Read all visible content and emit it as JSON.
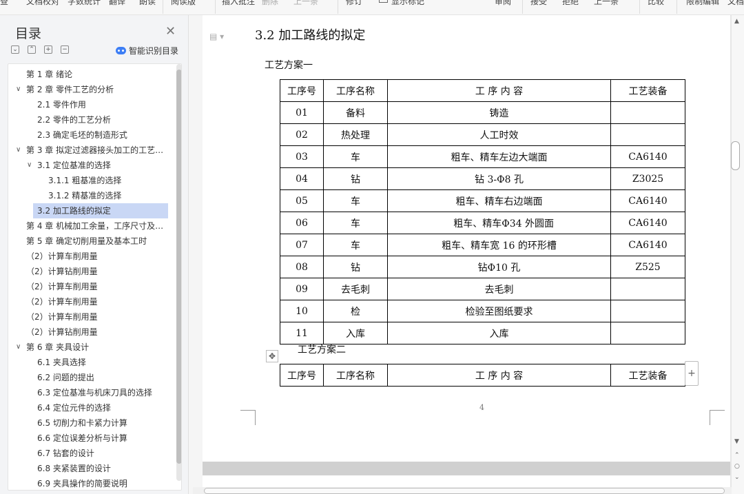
{
  "toolbar": {
    "items": [
      "查",
      "文档校对",
      "字数统计",
      "翻译",
      "朗读",
      "阅读版",
      "插入批注",
      "删除",
      "上一条",
      "下一条",
      "修订",
      "显示标记",
      "审阅",
      "接受",
      "拒绝",
      "上一条",
      "下一条",
      "比较",
      "限制编辑",
      "文档"
    ]
  },
  "nav": {
    "title": "目录",
    "smart_toc": "智能识别目录",
    "toc": [
      {
        "label": "第 1 章 绪论",
        "level": 0,
        "caret": ""
      },
      {
        "label": "第 2 章 零件工艺的分析",
        "level": 0,
        "caret": "∨"
      },
      {
        "label": "2.1 零件作用",
        "level": 1,
        "caret": ""
      },
      {
        "label": "2.2 零件的工艺分析",
        "level": 1,
        "caret": ""
      },
      {
        "label": "2.3 确定毛坯的制造形式",
        "level": 1,
        "caret": ""
      },
      {
        "label": "第 3 章 拟定过滤器接头加工的工艺…",
        "level": 0,
        "caret": "∨"
      },
      {
        "label": "3.1 定位基准的选择",
        "level": 1,
        "caret": "∨"
      },
      {
        "label": "3.1.1 粗基准的选择",
        "level": 2,
        "caret": ""
      },
      {
        "label": "3.1.2 精基准的选择",
        "level": 2,
        "caret": ""
      },
      {
        "label": "3.2 加工路线的拟定",
        "level": 1,
        "caret": "",
        "selected": true
      },
      {
        "label": "第 4 章 机械加工余量，工序尺寸及…",
        "level": 0,
        "caret": ""
      },
      {
        "label": "第 5 章 确定切削用量及基本工时",
        "level": 0,
        "caret": ""
      },
      {
        "label": "（2）计算车削用量",
        "level": 0,
        "caret": ""
      },
      {
        "label": "（2）计算钻削用量",
        "level": 0,
        "caret": ""
      },
      {
        "label": "（2）计算车削用量",
        "level": 0,
        "caret": ""
      },
      {
        "label": "（2）计算车削用量",
        "level": 0,
        "caret": ""
      },
      {
        "label": "（2）计算车削用量",
        "level": 0,
        "caret": ""
      },
      {
        "label": "（2）计算钻削用量",
        "level": 0,
        "caret": ""
      },
      {
        "label": "第 6 章 夹具设计",
        "level": 0,
        "caret": "∨"
      },
      {
        "label": "6.1 夹具选择",
        "level": 1,
        "caret": ""
      },
      {
        "label": "6.2 问题的提出",
        "level": 1,
        "caret": ""
      },
      {
        "label": "6.3 定位基准与机床刀具的选择",
        "level": 1,
        "caret": ""
      },
      {
        "label": "6.4 定位元件的选择",
        "level": 1,
        "caret": ""
      },
      {
        "label": "6.5 切削力和卡紧力计算",
        "level": 1,
        "caret": ""
      },
      {
        "label": "6.6 定位误差分析与计算",
        "level": 1,
        "caret": ""
      },
      {
        "label": "6.7 钻套的设计",
        "level": 1,
        "caret": ""
      },
      {
        "label": "6.8 夹紧装置的设计",
        "level": 1,
        "caret": ""
      },
      {
        "label": "6.9 夹具操作的简要说明",
        "level": 1,
        "caret": ""
      }
    ]
  },
  "doc": {
    "heading": "3.2 加工路线的拟定",
    "plan1_title": "工艺方案一",
    "plan2_title": "工艺方案二",
    "headers": [
      "工序号",
      "工序名称",
      "工  序   内    容",
      "工艺装备"
    ],
    "plan1_rows": [
      [
        "01",
        "备料",
        "铸造",
        ""
      ],
      [
        "02",
        "热处理",
        "人工时效",
        ""
      ],
      [
        "03",
        "车",
        "粗车、精车左边大端面",
        "CA6140"
      ],
      [
        "04",
        "钻",
        "钻 3-Φ8 孔",
        "Z3025"
      ],
      [
        "05",
        "车",
        "粗车、精车右边端面",
        "CA6140"
      ],
      [
        "06",
        "车",
        "   粗车、精车Φ34 外圆面",
        "CA6140"
      ],
      [
        "07",
        "车",
        "粗车、精车宽 16 的环形槽",
        "CA6140"
      ],
      [
        "08",
        "钻",
        "钻Φ10 孔",
        "Z525"
      ],
      [
        "09",
        "去毛刺",
        "去毛刺",
        ""
      ],
      [
        "10",
        "检",
        "检验至图纸要求",
        ""
      ],
      [
        "11",
        "入库",
        "入库",
        ""
      ]
    ],
    "page_number": "4"
  }
}
